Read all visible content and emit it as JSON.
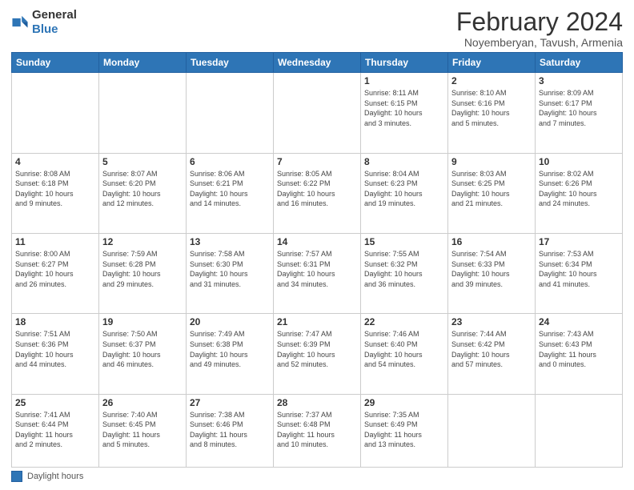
{
  "logo": {
    "general": "General",
    "blue": "Blue"
  },
  "title": "February 2024",
  "subtitle": "Noyemberyan, Tavush, Armenia",
  "days_of_week": [
    "Sunday",
    "Monday",
    "Tuesday",
    "Wednesday",
    "Thursday",
    "Friday",
    "Saturday"
  ],
  "footer": {
    "legend_label": "Daylight hours"
  },
  "weeks": [
    [
      {
        "day": "",
        "info": ""
      },
      {
        "day": "",
        "info": ""
      },
      {
        "day": "",
        "info": ""
      },
      {
        "day": "",
        "info": ""
      },
      {
        "day": "1",
        "info": "Sunrise: 8:11 AM\nSunset: 6:15 PM\nDaylight: 10 hours\nand 3 minutes."
      },
      {
        "day": "2",
        "info": "Sunrise: 8:10 AM\nSunset: 6:16 PM\nDaylight: 10 hours\nand 5 minutes."
      },
      {
        "day": "3",
        "info": "Sunrise: 8:09 AM\nSunset: 6:17 PM\nDaylight: 10 hours\nand 7 minutes."
      }
    ],
    [
      {
        "day": "4",
        "info": "Sunrise: 8:08 AM\nSunset: 6:18 PM\nDaylight: 10 hours\nand 9 minutes."
      },
      {
        "day": "5",
        "info": "Sunrise: 8:07 AM\nSunset: 6:20 PM\nDaylight: 10 hours\nand 12 minutes."
      },
      {
        "day": "6",
        "info": "Sunrise: 8:06 AM\nSunset: 6:21 PM\nDaylight: 10 hours\nand 14 minutes."
      },
      {
        "day": "7",
        "info": "Sunrise: 8:05 AM\nSunset: 6:22 PM\nDaylight: 10 hours\nand 16 minutes."
      },
      {
        "day": "8",
        "info": "Sunrise: 8:04 AM\nSunset: 6:23 PM\nDaylight: 10 hours\nand 19 minutes."
      },
      {
        "day": "9",
        "info": "Sunrise: 8:03 AM\nSunset: 6:25 PM\nDaylight: 10 hours\nand 21 minutes."
      },
      {
        "day": "10",
        "info": "Sunrise: 8:02 AM\nSunset: 6:26 PM\nDaylight: 10 hours\nand 24 minutes."
      }
    ],
    [
      {
        "day": "11",
        "info": "Sunrise: 8:00 AM\nSunset: 6:27 PM\nDaylight: 10 hours\nand 26 minutes."
      },
      {
        "day": "12",
        "info": "Sunrise: 7:59 AM\nSunset: 6:28 PM\nDaylight: 10 hours\nand 29 minutes."
      },
      {
        "day": "13",
        "info": "Sunrise: 7:58 AM\nSunset: 6:30 PM\nDaylight: 10 hours\nand 31 minutes."
      },
      {
        "day": "14",
        "info": "Sunrise: 7:57 AM\nSunset: 6:31 PM\nDaylight: 10 hours\nand 34 minutes."
      },
      {
        "day": "15",
        "info": "Sunrise: 7:55 AM\nSunset: 6:32 PM\nDaylight: 10 hours\nand 36 minutes."
      },
      {
        "day": "16",
        "info": "Sunrise: 7:54 AM\nSunset: 6:33 PM\nDaylight: 10 hours\nand 39 minutes."
      },
      {
        "day": "17",
        "info": "Sunrise: 7:53 AM\nSunset: 6:34 PM\nDaylight: 10 hours\nand 41 minutes."
      }
    ],
    [
      {
        "day": "18",
        "info": "Sunrise: 7:51 AM\nSunset: 6:36 PM\nDaylight: 10 hours\nand 44 minutes."
      },
      {
        "day": "19",
        "info": "Sunrise: 7:50 AM\nSunset: 6:37 PM\nDaylight: 10 hours\nand 46 minutes."
      },
      {
        "day": "20",
        "info": "Sunrise: 7:49 AM\nSunset: 6:38 PM\nDaylight: 10 hours\nand 49 minutes."
      },
      {
        "day": "21",
        "info": "Sunrise: 7:47 AM\nSunset: 6:39 PM\nDaylight: 10 hours\nand 52 minutes."
      },
      {
        "day": "22",
        "info": "Sunrise: 7:46 AM\nSunset: 6:40 PM\nDaylight: 10 hours\nand 54 minutes."
      },
      {
        "day": "23",
        "info": "Sunrise: 7:44 AM\nSunset: 6:42 PM\nDaylight: 10 hours\nand 57 minutes."
      },
      {
        "day": "24",
        "info": "Sunrise: 7:43 AM\nSunset: 6:43 PM\nDaylight: 11 hours\nand 0 minutes."
      }
    ],
    [
      {
        "day": "25",
        "info": "Sunrise: 7:41 AM\nSunset: 6:44 PM\nDaylight: 11 hours\nand 2 minutes."
      },
      {
        "day": "26",
        "info": "Sunrise: 7:40 AM\nSunset: 6:45 PM\nDaylight: 11 hours\nand 5 minutes."
      },
      {
        "day": "27",
        "info": "Sunrise: 7:38 AM\nSunset: 6:46 PM\nDaylight: 11 hours\nand 8 minutes."
      },
      {
        "day": "28",
        "info": "Sunrise: 7:37 AM\nSunset: 6:48 PM\nDaylight: 11 hours\nand 10 minutes."
      },
      {
        "day": "29",
        "info": "Sunrise: 7:35 AM\nSunset: 6:49 PM\nDaylight: 11 hours\nand 13 minutes."
      },
      {
        "day": "",
        "info": ""
      },
      {
        "day": "",
        "info": ""
      }
    ]
  ]
}
